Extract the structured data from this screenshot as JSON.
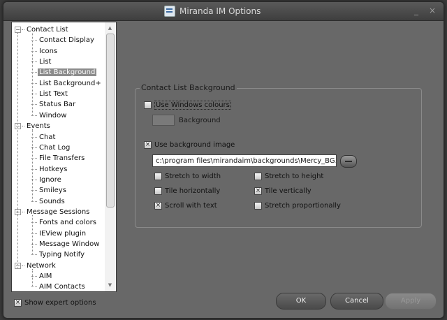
{
  "window": {
    "title": "Miranda IM Options",
    "minimize_glyph": "_",
    "close_glyph": "×"
  },
  "tree": [
    {
      "label": "Contact List",
      "level": 0,
      "expander": "−"
    },
    {
      "label": "Contact Display",
      "level": 1
    },
    {
      "label": "Icons",
      "level": 1
    },
    {
      "label": "List",
      "level": 1
    },
    {
      "label": "List Background",
      "level": 1,
      "selected": true
    },
    {
      "label": "List Background+",
      "level": 1
    },
    {
      "label": "List Text",
      "level": 1
    },
    {
      "label": "Status Bar",
      "level": 1
    },
    {
      "label": "Window",
      "level": 1
    },
    {
      "label": "Events",
      "level": 0,
      "expander": "−"
    },
    {
      "label": "Chat",
      "level": 1
    },
    {
      "label": "Chat Log",
      "level": 1
    },
    {
      "label": "File Transfers",
      "level": 1
    },
    {
      "label": "Hotkeys",
      "level": 1
    },
    {
      "label": "Ignore",
      "level": 1
    },
    {
      "label": "Smileys",
      "level": 1
    },
    {
      "label": "Sounds",
      "level": 1
    },
    {
      "label": "Message Sessions",
      "level": 0,
      "expander": "−"
    },
    {
      "label": "Fonts and colors",
      "level": 1
    },
    {
      "label": "IEView plugin",
      "level": 1
    },
    {
      "label": "Message Window",
      "level": 1
    },
    {
      "label": "Typing Notify",
      "level": 1
    },
    {
      "label": "Network",
      "level": 0,
      "expander": "−"
    },
    {
      "label": "AIM",
      "level": 1
    },
    {
      "label": "AIM Contacts",
      "level": 1
    }
  ],
  "panel": {
    "group_title": "Contact List Background",
    "use_windows_colours": {
      "label": "Use Windows colours",
      "checked": false
    },
    "background_label": "Background",
    "use_background_image": {
      "label": "Use background image",
      "checked": true
    },
    "image_path": "c:\\program files\\mirandaim\\backgrounds\\Mercy_BG.jpg",
    "options": {
      "stretch_width": {
        "label": "Stretch to width",
        "checked": false
      },
      "stretch_height": {
        "label": "Stretch to height",
        "checked": false
      },
      "tile_h": {
        "label": "Tile horizontally",
        "checked": false
      },
      "tile_v": {
        "label": "Tile vertically",
        "checked": true
      },
      "scroll_text": {
        "label": "Scroll with text",
        "checked": true
      },
      "stretch_prop": {
        "label": "Stretch proportionally",
        "checked": false
      }
    }
  },
  "footer": {
    "expert": {
      "label": "Show expert options",
      "checked": true
    },
    "ok_label": "OK",
    "cancel_label": "Cancel",
    "apply_label": "Apply"
  },
  "glyphs": {
    "check": "×",
    "scroll_up": "▲",
    "scroll_down": "▼"
  }
}
